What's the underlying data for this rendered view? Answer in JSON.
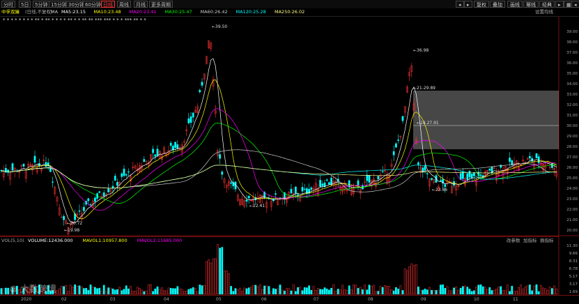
{
  "periods": [
    "分时",
    "5日",
    "5分钟",
    "15分钟",
    "30分钟",
    "60分钟",
    "日线",
    "周线",
    "月线",
    "更多周期"
  ],
  "active_period": "日线",
  "right_buttons": [
    "复权",
    "叠加",
    "画线",
    "幂线",
    "经典"
  ],
  "stock_name": "中孚双嫲",
  "stock_mode": "(日线,不复权)",
  "ma_items": [
    {
      "label": "MA",
      "value": "",
      "color": "#cccccc"
    },
    {
      "label": "MA5:",
      "value": "23.15",
      "color": "#ffffff"
    },
    {
      "label": "MA10:",
      "value": "23.48",
      "color": "#ffff00"
    },
    {
      "label": "MA20:",
      "value": "23.41",
      "color": "#ff00ff"
    },
    {
      "label": "MA30:",
      "value": "25.47",
      "color": "#00ff00"
    },
    {
      "label": "MA60:",
      "value": "26.42",
      "color": "#cccccc"
    },
    {
      "label": "MA120:",
      "value": "25.28",
      "color": "#00ffff"
    },
    {
      "label": "MA250:",
      "value": "26.02",
      "color": "#ffff88"
    }
  ],
  "settings_label": "设置均线",
  "price_ticks": [
    "39.00",
    "38.00",
    "37.00",
    "36.00",
    "35.00",
    "34.00",
    "33.00",
    "32.00",
    "31.00",
    "30.00",
    "29.00",
    "28.00",
    "27.00",
    "26.00",
    "25.00",
    "24.00",
    "23.00",
    "22.00",
    "21.00",
    "20.00"
  ],
  "annotations": [
    {
      "text": "39.50"
    },
    {
      "text": "20.72"
    },
    {
      "text": "19.98"
    },
    {
      "text": "22.41"
    },
    {
      "text": "36.98"
    },
    {
      "text": "21-29.89"
    },
    {
      "text": "23.86"
    },
    {
      "text": "28.27.91"
    }
  ],
  "volume": {
    "title": "VOL(5,10)",
    "items": [
      {
        "label": "VOLUME:",
        "value": "12436.000",
        "color": "#ffffff"
      },
      {
        "label": "MAVOL1:",
        "value": "10957.800",
        "color": "#ffff00"
      },
      {
        "label": "MAVOL2:",
        "value": "11685.000",
        "color": "#ff00ff"
      }
    ],
    "right_buttons": [
      "改参数",
      "加指标",
      "换指标"
    ],
    "ticks": [
      "11.30",
      "9.66",
      "8.31",
      "6.78",
      "5.17",
      "3.17",
      "1.69"
    ]
  },
  "x_labels": [
    "2020",
    "02",
    "03",
    "04",
    "05",
    "06",
    "07",
    "08",
    "09",
    "10",
    "11"
  ],
  "watermark": "大数跨境",
  "colors": {
    "up": "#ff3232",
    "down": "#00ffff",
    "frame": "#7a1010"
  }
}
